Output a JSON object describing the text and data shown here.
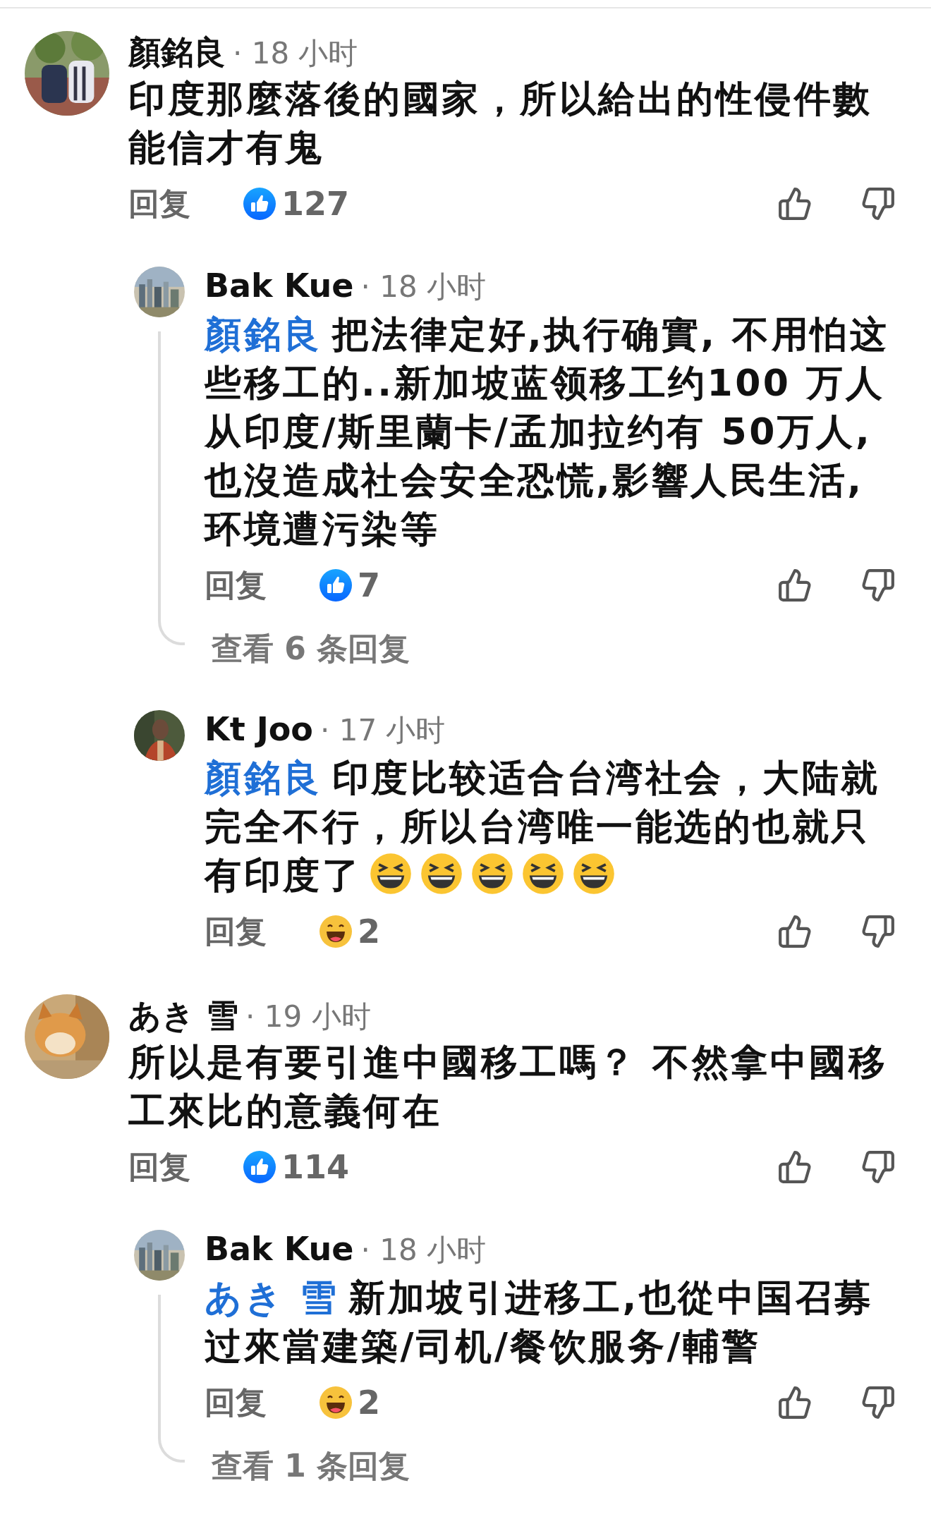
{
  "comments": [
    {
      "author": "顏銘良",
      "time": "· 18 小时",
      "avatar": {
        "kind": "picture"
      },
      "body": "印度那麼落後的國家，所以給出的性侵件數能信才有鬼",
      "reply_label": "回复",
      "reaction": {
        "kind": "like",
        "count": "127"
      },
      "replies": [
        {
          "author": "Bak Kue",
          "time": "· 18 小时",
          "avatar": {
            "kind": "picture"
          },
          "mention": "顏銘良",
          "body": "把法律定好,执行确實, 不用怕这些移工的..新加坡蓝领移工约100 万人从印度/斯里蘭卡/孟加拉约有 50万人,也沒造成社会安全恐慌,影響人民生活,环境遭污染等",
          "reply_label": "回复",
          "reaction": {
            "kind": "like",
            "count": "7"
          },
          "view_more": "查看 6 条回复"
        },
        {
          "author": "Kt Joo",
          "time": "· 17 小时",
          "avatar": {
            "kind": "picture"
          },
          "mention": "顏銘良",
          "body": "印度比较适合台湾社会，大陆就完全不行，所以台湾唯一能选的也就只有印度了",
          "emojis": [
            {
              "kind": "grinning-squint"
            },
            {
              "kind": "grinning-squint"
            },
            {
              "kind": "grinning-squint"
            },
            {
              "kind": "grinning-squint"
            },
            {
              "kind": "grinning-squint"
            }
          ],
          "reply_label": "回复",
          "reaction": {
            "kind": "haha",
            "count": "2"
          }
        }
      ]
    },
    {
      "author": "あき 雪",
      "time": "· 19 小时",
      "avatar": {
        "kind": "picture"
      },
      "body": "所以是有要引進中國移工嗎？ 不然拿中國移工來比的意義何在",
      "reply_label": "回复",
      "reaction": {
        "kind": "like",
        "count": "114"
      },
      "replies": [
        {
          "author": "Bak Kue",
          "time": "· 18 小时",
          "avatar": {
            "kind": "picture"
          },
          "mention": "あき 雪",
          "body": "新加坡引进移工,也從中国召募过來當建築/司机/餐饮服务/輔警",
          "reply_label": "回复",
          "reaction": {
            "kind": "haha",
            "count": "2"
          },
          "view_more": "查看 1 条回复"
        }
      ]
    }
  ]
}
